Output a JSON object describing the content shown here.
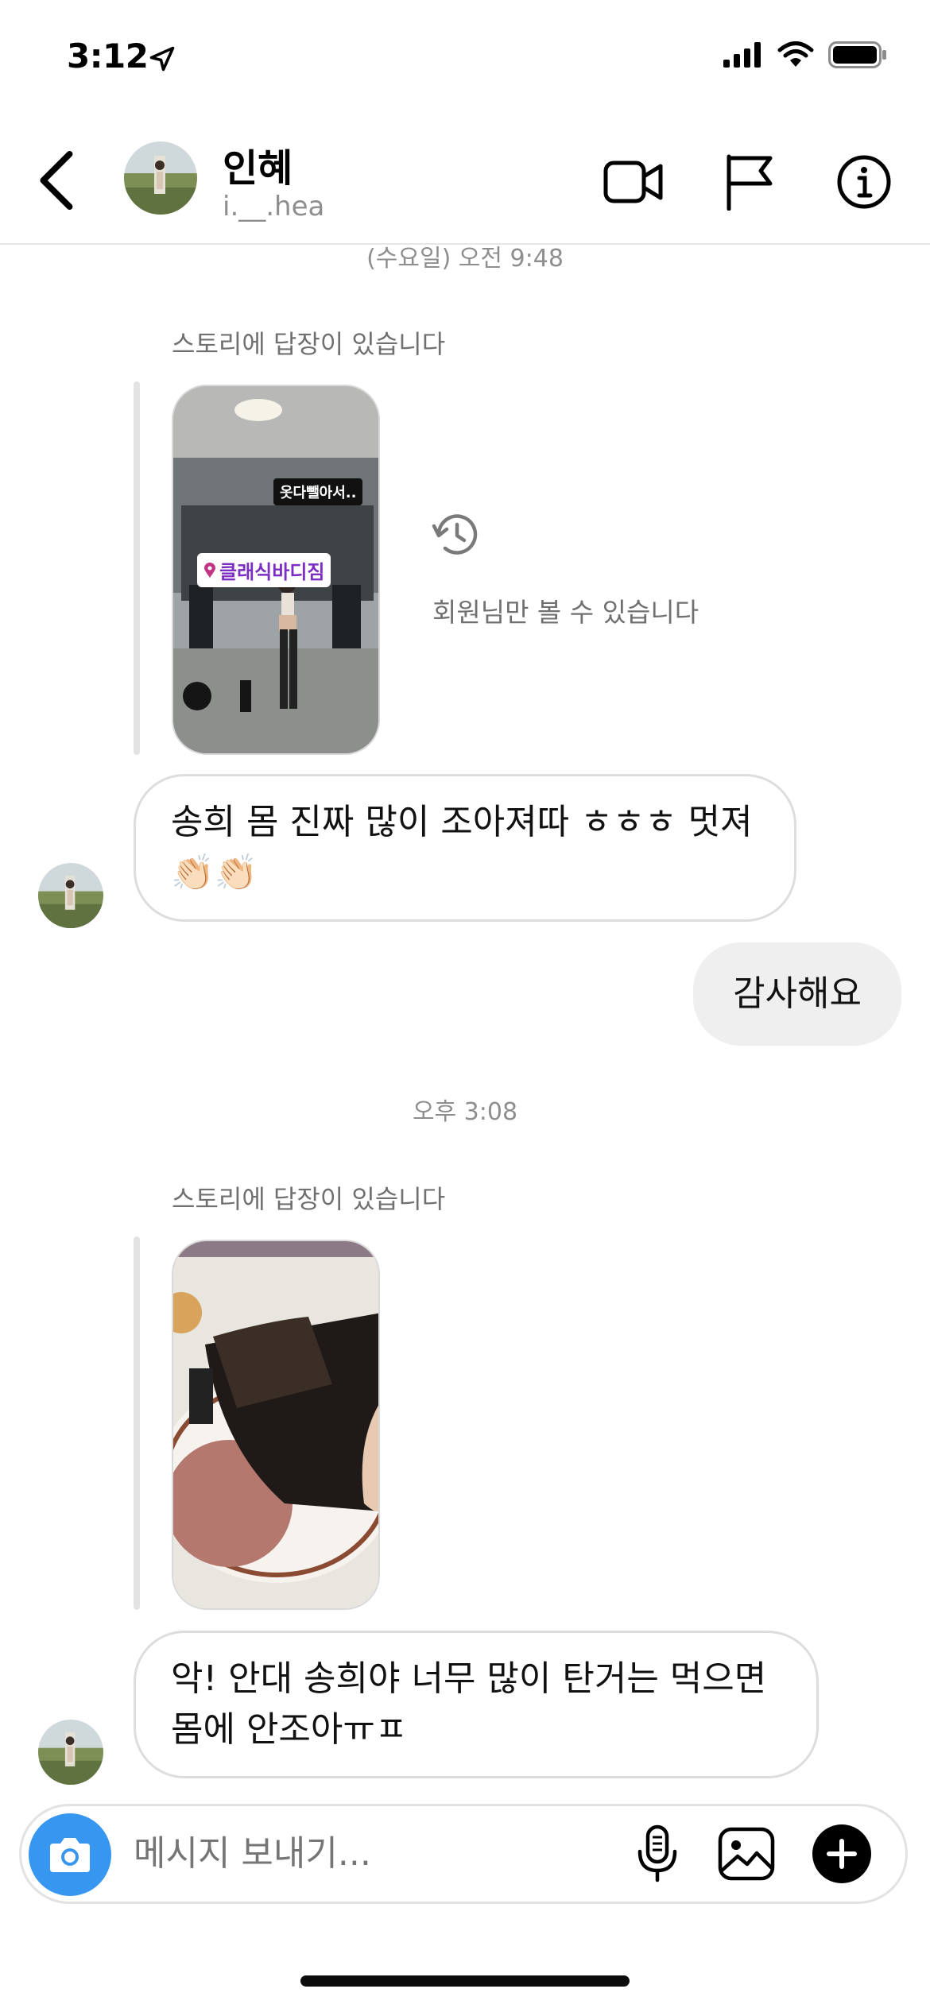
{
  "status_bar": {
    "time": "3:12"
  },
  "header": {
    "name": "인혜",
    "handle": "i.__.hea"
  },
  "thread": {
    "timestamp_top": "(수요일) 오전 9:48",
    "story_reply_label_1": "스토리에 답장이 있습니다",
    "story1": {
      "sticker_text": "옷다뺄아서..",
      "location_text": "클래식바디짐"
    },
    "members_only_text": "회원님만 볼 수 있습니다",
    "message_in_1": "송희 몸 진짜 많이 조아져따 ㅎㅎㅎ 멋져 👏🏻👏🏻",
    "message_out_1": "감사해요",
    "timestamp_2": "오후 3:08",
    "story_reply_label_2": "스토리에 답장이 있습니다",
    "message_in_2": "악! 안대 송희야 너무 많이 탄거는 먹으면 몸에 안조아ㅠㅍ"
  },
  "composer": {
    "placeholder": "메시지 보내기..."
  },
  "icons": {
    "back": "chevron-left-icon",
    "video": "video-camera-icon",
    "flag": "flag-icon",
    "info": "info-icon",
    "history": "history-icon",
    "camera": "camera-icon",
    "mic": "microphone-icon",
    "gallery": "image-icon",
    "add": "plus-circle-icon"
  },
  "colors": {
    "accent": "#3797f0",
    "text_secondary": "#8e8e8e",
    "bubble_out": "#efefef"
  }
}
